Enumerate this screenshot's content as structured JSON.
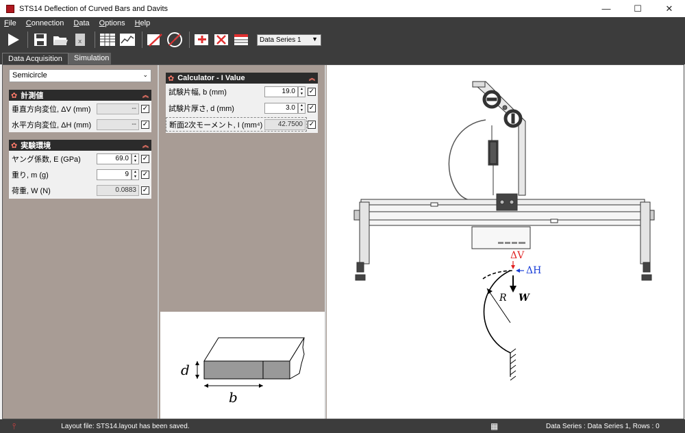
{
  "window": {
    "title": "STS14 Deflection of Curved Bars and Davits",
    "minimize": "—",
    "maximize": "☐",
    "close": "✕"
  },
  "menu": [
    {
      "label": "File",
      "accel": "F",
      "rest": "ile"
    },
    {
      "label": "Connection",
      "accel": "C",
      "rest": "onnection"
    },
    {
      "label": "Data",
      "accel": "D",
      "rest": "ata"
    },
    {
      "label": "Options",
      "accel": "O",
      "rest": "ptions"
    },
    {
      "label": "Help",
      "accel": "H",
      "rest": "elp"
    }
  ],
  "toolbar": {
    "icons": [
      "play-icon",
      "save-icon",
      "open-folder-icon",
      "export-excel-icon",
      "table-view-icon",
      "graph-view-icon",
      "edit-table-icon",
      "gauge-zero-icon",
      "add-series-icon",
      "delete-series-icon",
      "series-table-icon"
    ],
    "series_select": "Data Series 1"
  },
  "tabs": {
    "active": "Data Acquisition",
    "inactive": "Simulation"
  },
  "left": {
    "shape_select": "Semicircle",
    "measured": {
      "title": "計測値",
      "rows": [
        {
          "label": "垂直方向変位, ΔV (mm)",
          "value": "--"
        },
        {
          "label": "水平方向変位, ΔH (mm)",
          "value": "--"
        }
      ]
    },
    "environment": {
      "title": "実験環境",
      "rows": [
        {
          "label": "ヤング係数, E (GPa)",
          "value": "69.0"
        },
        {
          "label": "重り, m (g)",
          "value": "9"
        },
        {
          "label": "荷重, W (N)",
          "value": "0.0883"
        }
      ]
    }
  },
  "calculator": {
    "title": "Calculator - I Value",
    "rows": [
      {
        "label": "試験片幅, b (mm)",
        "value": "19.0"
      },
      {
        "label": "試験片厚さ, d (mm)",
        "value": "3.0"
      },
      {
        "label": "断面2次モーメント, I (mm⁴)",
        "value": "42.7500"
      }
    ]
  },
  "crosssection": {
    "d_label": "d",
    "b_label": "b"
  },
  "diagram": {
    "dv_label": "ΔV",
    "dh_label": "ΔH",
    "r_label": "R",
    "w_label": "W"
  },
  "status": {
    "layout_msg": "Layout file: STS14.layout has been saved.",
    "series_info": "Data Series : Data Series 1,  Rows : 0"
  }
}
